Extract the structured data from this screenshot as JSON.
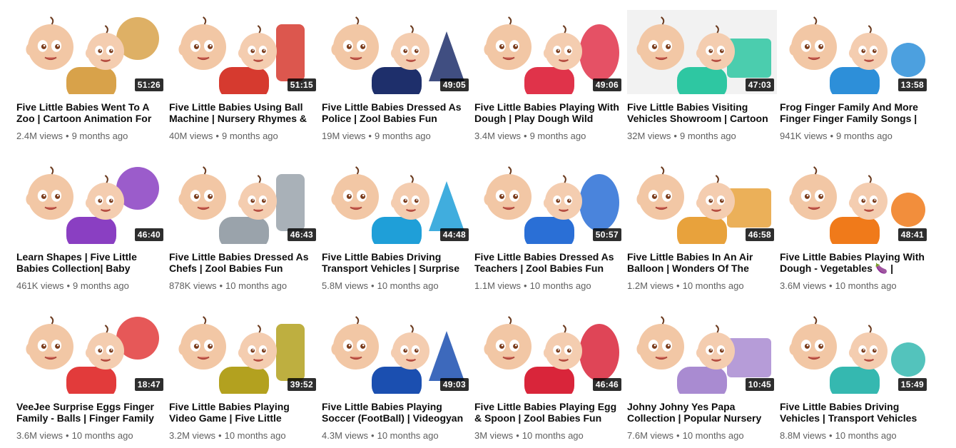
{
  "theme": {
    "bg": "#ffffff",
    "title_color": "#0d0d0d",
    "meta_color": "#606060",
    "duration_bg": "#000000"
  },
  "videos": [
    {
      "title": "Five Little Babies Went To A Zoo | Cartoon Animation For",
      "views": "2.4M views",
      "age": "9 months ago",
      "duration": "51:26",
      "bg": "#ffffff",
      "accent": "#d8a24a",
      "icon": "baby-with-giraffe-thumbnail"
    },
    {
      "title": "Five Little Babies Using Ball Machine | Nursery Rhymes &",
      "views": "40M views",
      "age": "9 months ago",
      "duration": "51:15",
      "bg": "#ffffff",
      "accent": "#d63a2f",
      "icon": "gumball-machine-thumbnail"
    },
    {
      "title": "Five Little Babies Dressed As Police | Zool Babies Fun",
      "views": "19M views",
      "age": "9 months ago",
      "duration": "49:05",
      "bg": "#ffffff",
      "accent": "#1e2f6b",
      "icon": "police-babies-thumbnail"
    },
    {
      "title": "Five Little Babies Playing With Dough | Play Dough Wild",
      "views": "3.4M views",
      "age": "9 months ago",
      "duration": "49:06",
      "bg": "#ffffff",
      "accent": "#e0334a",
      "icon": "play-dough-thumbnail"
    },
    {
      "title": "Five Little Babies Visiting Vehicles Showroom | Cartoon",
      "views": "32M views",
      "age": "9 months ago",
      "duration": "47:03",
      "bg": "#f2f2f2",
      "accent": "#2ec7a2",
      "icon": "vehicles-showroom-thumbnail"
    },
    {
      "title": "Frog Finger Family And More Finger Finger Family Songs |",
      "views": "941K views",
      "age": "9 months ago",
      "duration": "13:58",
      "bg": "#ffffff",
      "accent": "#2d8fd9",
      "icon": "frog-finger-family-thumbnail"
    },
    {
      "title": "Learn Shapes | Five Little Babies Collection| Baby",
      "views": "461K views",
      "age": "9 months ago",
      "duration": "46:40",
      "bg": "#ffffff",
      "accent": "#8a3fc2",
      "icon": "shapes-thumbnail"
    },
    {
      "title": "Five Little Babies Dressed As Chefs | Zool Babies Fun",
      "views": "878K views",
      "age": "10 months ago",
      "duration": "46:43",
      "bg": "#ffffff",
      "accent": "#9aa3ab",
      "icon": "chef-babies-thumbnail"
    },
    {
      "title": "Five Little Babies Driving Transport Vehicles | Surprise",
      "views": "5.8M views",
      "age": "10 months ago",
      "duration": "44:48",
      "bg": "#ffffff",
      "accent": "#1f9fd8",
      "icon": "monster-truck-thumbnail"
    },
    {
      "title": "Five Little Babies Dressed As Teachers | Zool Babies Fun",
      "views": "1.1M views",
      "age": "10 months ago",
      "duration": "50:57",
      "bg": "#ffffff",
      "accent": "#2a6fd6",
      "icon": "teacher-babies-thumbnail"
    },
    {
      "title": "Five Little Babies In An Air Balloon | Wonders Of The",
      "views": "1.2M views",
      "age": "10 months ago",
      "duration": "46:58",
      "bg": "#ffffff",
      "accent": "#e8a23c",
      "icon": "air-balloon-thumbnail"
    },
    {
      "title": "Five Little Babies Playing With Dough - Vegetables 🍆 |",
      "views": "3.6M views",
      "age": "10 months ago",
      "duration": "48:41",
      "bg": "#ffffff",
      "accent": "#f07a1a",
      "icon": "vegetables-thumbnail"
    },
    {
      "title": "VeeJee Surprise Eggs Finger Family - Balls | Finger Family",
      "views": "3.6M views",
      "age": "10 months ago",
      "duration": "18:47",
      "bg": "#ffffff",
      "accent": "#e23b3b",
      "icon": "surprise-eggs-thumbnail"
    },
    {
      "title": "Five Little Babies Playing Video Game | Five Little",
      "views": "3.2M views",
      "age": "10 months ago",
      "duration": "39:52",
      "bg": "#ffffff",
      "accent": "#b3a11f",
      "icon": "video-game-thumbnail"
    },
    {
      "title": "Five Little Babies Playing Soccer (FootBall) | Videogyan",
      "views": "4.3M views",
      "age": "10 months ago",
      "duration": "49:03",
      "bg": "#ffffff",
      "accent": "#1b4fb0",
      "icon": "soccer-thumbnail"
    },
    {
      "title": "Five Little Babies Playing Egg & Spoon | Zool Babies Fun",
      "views": "3M views",
      "age": "10 months ago",
      "duration": "46:46",
      "bg": "#ffffff",
      "accent": "#d9253a",
      "icon": "easter-egg-thumbnail"
    },
    {
      "title": "Johny Johny Yes Papa Collection | Popular Nursery",
      "views": "7.6M views",
      "age": "10 months ago",
      "duration": "10:45",
      "bg": "#ffffff",
      "accent": "#a98bd1",
      "icon": "johny-johny-thumbnail"
    },
    {
      "title": "Five Little Babies Driving Vehicles | Transport Vehicles",
      "views": "8.8M views",
      "age": "10 months ago",
      "duration": "15:49",
      "bg": "#ffffff",
      "accent": "#35b8b0",
      "icon": "vintage-car-thumbnail"
    }
  ]
}
